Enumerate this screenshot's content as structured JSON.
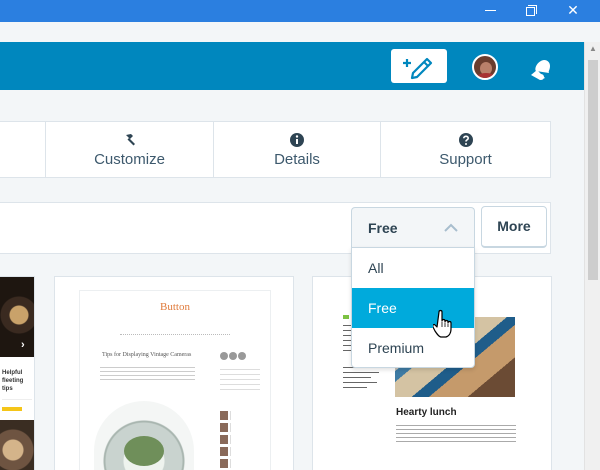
{
  "colors": {
    "titlebar": "#2b7fe0",
    "masterbar": "#0087be",
    "accent": "#00aadc",
    "text": "#2e4453"
  },
  "window": {
    "minimize_icon": "minimize-icon",
    "maximize_icon": "restore-icon",
    "close_icon": "close-icon"
  },
  "masterbar": {
    "write_icon": "write-post-icon",
    "avatar": "user-avatar",
    "notifications_icon": "notifications-bell-icon"
  },
  "actions": {
    "customize": {
      "label": "Customize",
      "icon": "hammer-icon"
    },
    "details": {
      "label": "Details",
      "icon": "info-icon"
    },
    "support": {
      "label": "Support",
      "icon": "help-icon"
    }
  },
  "filter": {
    "selected": "Free",
    "options": [
      "All",
      "Free",
      "Premium"
    ],
    "highlighted_index": 1,
    "more_label": "More"
  },
  "themes": {
    "card1": {
      "snippet": "Helpful fleeting tips"
    },
    "card2": {
      "brand": "Button",
      "post_title": "Tips for Displaying Vintage Cameras"
    },
    "card3": {
      "post_title": "Hearty lunch"
    }
  }
}
